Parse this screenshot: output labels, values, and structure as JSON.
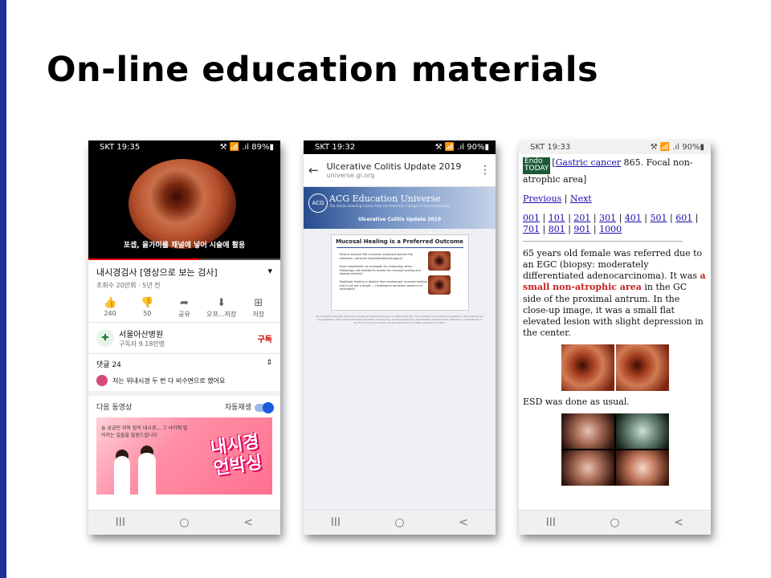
{
  "slide": {
    "title": "On-line education materials"
  },
  "phone1": {
    "status": {
      "time": "SKT 19:35",
      "icons": "⚒ 📶 .ıl 89%▮"
    },
    "video_caption": "포셉, 올가미를 채널에 넣어 시술에 활용",
    "progress": 0.58,
    "video_title": "내시경검사 [영상으로 보는 검사]",
    "meta": "조회수 20만회 · 5년 전",
    "actions": [
      {
        "icon": "thumbs-up-icon",
        "label": "240"
      },
      {
        "icon": "thumbs-down-icon",
        "label": "50"
      },
      {
        "icon": "share-icon",
        "label": "공유"
      },
      {
        "icon": "download-icon",
        "label": "오프...저장"
      },
      {
        "icon": "save-playlist-icon",
        "label": "저장"
      }
    ],
    "channel": {
      "name": "서울아산병원",
      "subs": "구독자 9.18만명",
      "subscribe": "구독"
    },
    "comments": {
      "label": "댓글",
      "count": "24",
      "first": "저는 위내시경 두 번 다 비수면으로 했어요"
    },
    "upnext": {
      "label": "다음 동영상",
      "autoplay": "자동재생"
    },
    "thumb": {
      "big_text": "내시경\n언박싱",
      "small_text": "늘 궁금던 위와 장의 내시경... 그 사이에 벌어지는 일들을 말씀드립니다"
    },
    "nav": [
      "III",
      "○",
      "<"
    ]
  },
  "phone2": {
    "status": {
      "time": "SKT 19:32",
      "icons": "⚒ 📶 .ıl 90%▮"
    },
    "url_title": "Ulcerative Colitis Update 2019",
    "url": "universe.gi.org",
    "banner_name": "ACG Education Universe",
    "banner_logo": "ACG",
    "banner_sub": "The Online Learning Center from the American College of Gastroenterology",
    "banner_title": "Ulcerative Colitis Update 2019",
    "slide_title": "Mucosal Healing is a Preferred Outcome",
    "bullets": [
      "Treat to achieve MH increases sustained steroid free remission, prevents hospitalizations/surgery?",
      "Fecal calprotectin as surrogate for endoscopy when endoscopy not feasible to assess for mucosal healing and disease activity?",
      "Histologic healing is distinct from endoscopic mucosal healing and is not yet a target — Histological remission absence of neutrophils"
    ],
    "fine_print": "All Contents Copyright American College of Gastroenterology. All rights reserved. The contents of all material available on this website are copyrighted by ACG unless otherwise indicated. Content may not be reproduced, downloaded, disseminated, published, or transferred in any form or by any means, except with the prior written permission of ACG.",
    "nav": [
      "III",
      "○",
      "<"
    ]
  },
  "phone3": {
    "status": {
      "time": "SKT 19:33",
      "icons": "⚒ 📶 .ıl 90%▮"
    },
    "logo_line1": "Endo",
    "logo_line2": "TODAY",
    "heading_link": "Gastric cancer",
    "heading_rest": " 865. Focal non-atrophic area]",
    "heading_open": "[",
    "prev": "Previous",
    "sep": " | ",
    "next": "Next",
    "pages": [
      "001",
      "101",
      "201",
      "301",
      "401",
      "501",
      "601",
      "701",
      "801",
      "901",
      "1000"
    ],
    "para1_a": "65 years old female was referred due to an EGC (biopsy: moderately differentiated adenocarcinoma). It was ",
    "para1_red": "a small non-atrophic area",
    "para1_b": " in the GC side of the proximal antrum. In the close-up image, it was a small flat elevated lesion with slight depression in the center.",
    "para2": "ESD was done as usual.",
    "nav": [
      "III",
      "○",
      "<"
    ]
  }
}
